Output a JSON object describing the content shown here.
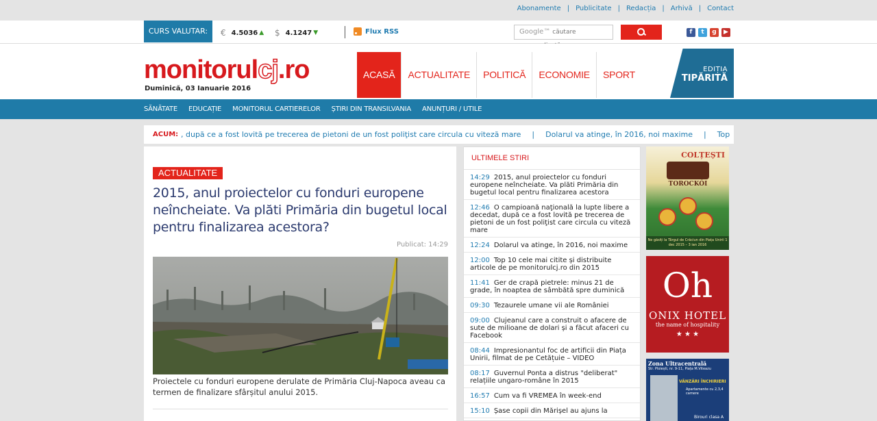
{
  "top_links": [
    "Abonamente",
    "Publicitate",
    "Redacția",
    "Arhivă",
    "Contact"
  ],
  "curs_valutar": {
    "label": "CURS VALUTAR:",
    "eur": {
      "symbol": "€",
      "value": "4.5036",
      "trend": "up"
    },
    "usd": {
      "symbol": "$",
      "value": "4.1247",
      "trend": "down"
    }
  },
  "rss_label": "Flux RSS",
  "search": {
    "brand": "Google™",
    "placeholder": "căutare personalizată"
  },
  "social_icons": [
    "facebook-icon",
    "twitter-icon",
    "google-plus-icon",
    "youtube-icon"
  ],
  "logo": {
    "part1": "monitorul",
    "part2": "cj",
    "part3": ".ro"
  },
  "date": "Duminică, 03 Ianuarie 2016",
  "main_nav": [
    {
      "label": "ACASĂ",
      "active": true
    },
    {
      "label": "ACTUALITATE",
      "active": false
    },
    {
      "label": "POLITICĂ",
      "active": false
    },
    {
      "label": "ECONOMIE",
      "active": false
    },
    {
      "label": "SPORT",
      "active": false
    }
  ],
  "print_edition": {
    "line1": "EDIȚIA",
    "line2": "TIPĂRITĂ"
  },
  "sub_nav": [
    "SĂNĂTATE",
    "EDUCAȚIE",
    "MONITORUL CARTIERELOR",
    "ȘTIRI DIN TRANSILVANIA",
    "ANUNȚURI / UTILE"
  ],
  "ticker": {
    "label": "ACUM:",
    "items": [
      ", după ce a fost lovită pe trecerea de pietoni de un fost poliţist care circula cu viteză mare",
      "Dolarul va atinge, în 2016, noi maxime",
      "Top"
    ],
    "separator": "|"
  },
  "article": {
    "category": "ACTUALITATE",
    "title": "2015, anul proiectelor cu fonduri europene neîncheiate. Va plăti Primăria din bugetul local pentru finalizarea acestora?",
    "published": "Publicat: 14:29",
    "caption": "Proiectele cu fonduri europene derulate de Primăria Cluj-Napoca aveau ca termen de finalizare sfârșitul anului 2015."
  },
  "latest_news": {
    "heading": "ULTIMELE STIRI",
    "items": [
      {
        "time": "14:29",
        "text": "2015, anul proiectelor cu fonduri europene neîncheiate. Va plăti Primăria din bugetul local pentru finalizarea acestora"
      },
      {
        "time": "12:46",
        "text": "O campioană naţională la lupte libere a decedat, după ce a fost lovită pe trecerea de pietoni de un fost poliţist care circula cu viteză mare"
      },
      {
        "time": "12:24",
        "text": "Dolarul va atinge, în 2016, noi maxime"
      },
      {
        "time": "12:00",
        "text": "Top 10 cele mai citite și distribuite articole de pe monitorulcj.ro din 2015"
      },
      {
        "time": "11:41",
        "text": "Ger de crapă pietrele: minus 21 de grade, în noaptea de sâmbătă spre duminică"
      },
      {
        "time": "09:30",
        "text": "Tezaurele umane vii ale României"
      },
      {
        "time": "09:00",
        "text": "Clujeanul care a construit o afacere de sute de milioane de dolari și a făcut afaceri cu Facebook"
      },
      {
        "time": "08:44",
        "text": "Impresionantul foc de artificii din Piața Unirii, filmat de pe Cetățuie – VIDEO"
      },
      {
        "time": "08:17",
        "text": "Guvernul Ponta a distrus \"deliberat\" relațiile ungaro-române în 2015"
      },
      {
        "time": "16:57",
        "text": "Cum va fi VREMEA în week-end"
      },
      {
        "time": "15:10",
        "text": "Șase copii din Mărișel au ajuns la"
      }
    ]
  },
  "ads": {
    "ad1": {
      "brand": "COLȚEȘTI",
      "product": "TOROCKÓI",
      "footer": "Ne găsiți la Târgul de Crăciun din Piața Unirii 1 dec 2015 – 3 ian 2016"
    },
    "ad2": {
      "big": "Oh",
      "name": "ONIX HOTEL",
      "tagline": "the name of hospitality",
      "stars": "★ ★ ★"
    },
    "ad3": {
      "line1": "Zona Ultracentrală",
      "line2": "Str. Ploiești, nr. 9-11, Piața M.Viteazu",
      "line3": "VÂNZĂRI ÎNCHIRIERI",
      "line4": "Apartamente cu 2,3,4 camere",
      "line5": "Birouri clasa A"
    }
  },
  "colors": {
    "brand_red": "#e3241b",
    "brand_blue": "#1f7ba8",
    "link_blue": "#1f7bb0",
    "title_navy": "#2b3a6e"
  }
}
